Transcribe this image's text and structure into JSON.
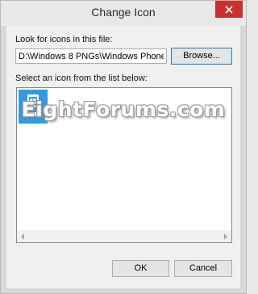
{
  "window": {
    "title": "Change Icon"
  },
  "file_section": {
    "label": "Look for icons in this file:",
    "path_value": "D:\\Windows 8 PNGs\\Windows Phone",
    "browse_label": "Browse..."
  },
  "icon_section": {
    "label": "Select an icon from the list below:",
    "selected_icon": "phone-icon",
    "selection_color": "#3399e0"
  },
  "watermark": "EightForums.com",
  "buttons": {
    "ok": "OK",
    "cancel": "Cancel"
  }
}
